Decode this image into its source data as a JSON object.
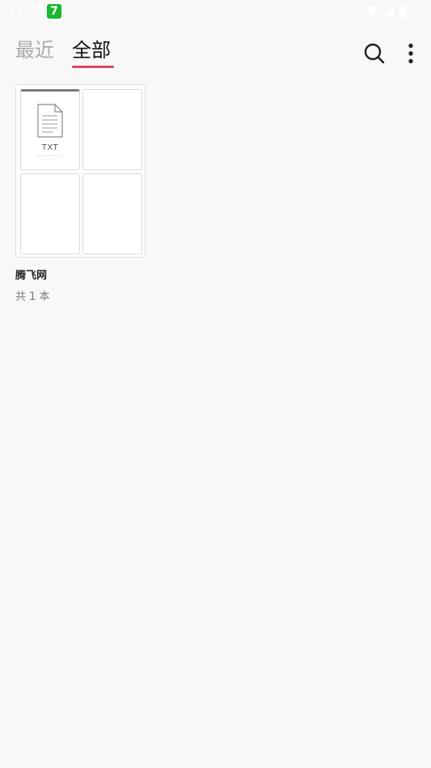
{
  "status_bar": {
    "time": "11:50",
    "app_badge": "7"
  },
  "header": {
    "tabs": [
      {
        "label": "最近",
        "active": false
      },
      {
        "label": "全部",
        "active": true
      }
    ],
    "search_icon": "search-icon",
    "more_icon": "more-vertical-icon",
    "accent_color": "#d84a5c"
  },
  "folder": {
    "name": "腾飞网",
    "count": "共 1 本",
    "books": [
      {
        "type": "TXT",
        "icon": "document-icon"
      }
    ]
  }
}
